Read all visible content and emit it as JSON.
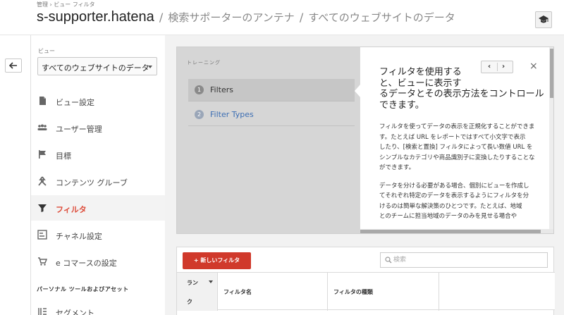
{
  "header": {
    "breadcrumb": "管理 › ビュー フィルタ",
    "title": "s-supporter.hatena",
    "separator": "/",
    "property": "検索サポーターのアンテナ",
    "view": "すべてのウェブサイトのデータ"
  },
  "sidebar": {
    "view_label": "ビュー",
    "view_selected": "すべてのウェブサイトのデータ",
    "items": [
      {
        "label": "ビュー設定",
        "icon": "document-icon"
      },
      {
        "label": "ユーザー管理",
        "icon": "users-icon"
      },
      {
        "label": "目標",
        "icon": "flag-icon"
      },
      {
        "label": "コンテンツ グルーブ",
        "icon": "content-group-icon"
      },
      {
        "label": "フィルタ",
        "icon": "filter-icon"
      },
      {
        "label": "チャネル設定",
        "icon": "channel-icon"
      },
      {
        "label": "e コマースの設定",
        "icon": "cart-icon"
      }
    ],
    "active_item": "フィルタ",
    "section_title": "パーソナル ツールおよびアセット",
    "section_items": [
      {
        "label": "セグメント",
        "icon": "segment-icon"
      }
    ]
  },
  "training": {
    "label": "トレーニング",
    "steps": [
      {
        "num": "1",
        "label": "Filters"
      },
      {
        "num": "2",
        "label": "Filter Types"
      }
    ],
    "pager_prev": "‹",
    "pager_next": "›",
    "close": "×",
    "tip_title_lines": [
      "フィルタを使用する",
      "と、ビューに表示す",
      "るデータとその表示方法をコントロール",
      "できます。"
    ],
    "tip_body_p1": [
      "フィルタを使ってデータの表示を正規化することができま",
      "す。たとえば URL をレポートではすべて小文字で表示",
      "したり、[検索と置換] フィルタによって長い数値 URL を",
      "シンプルなカテゴリや商品識別子に変換したりすることな",
      "ができます。"
    ],
    "tip_body_p2": [
      "データを分ける必要がある場合、個別にビューを作成し",
      "てそれぞれ特定のデータを表示するようにフィルタを分",
      "けるのは簡単な解決策のひとつです。たとえば、地域",
      "とのチームに担当地域のデータのみを見せる場合や"
    ]
  },
  "filters_table": {
    "new_button": "+ 新しいフィルタ",
    "search_placeholder": "検索",
    "columns": {
      "rank_line1": "ラン",
      "rank_line2": "ク",
      "name": "フィルタ名",
      "type": "フィルタの種類",
      "extra": ""
    }
  },
  "colors": {
    "accent_red": "#dd4b39",
    "button_red": "#d0392b",
    "link_blue": "#3b6db3"
  }
}
